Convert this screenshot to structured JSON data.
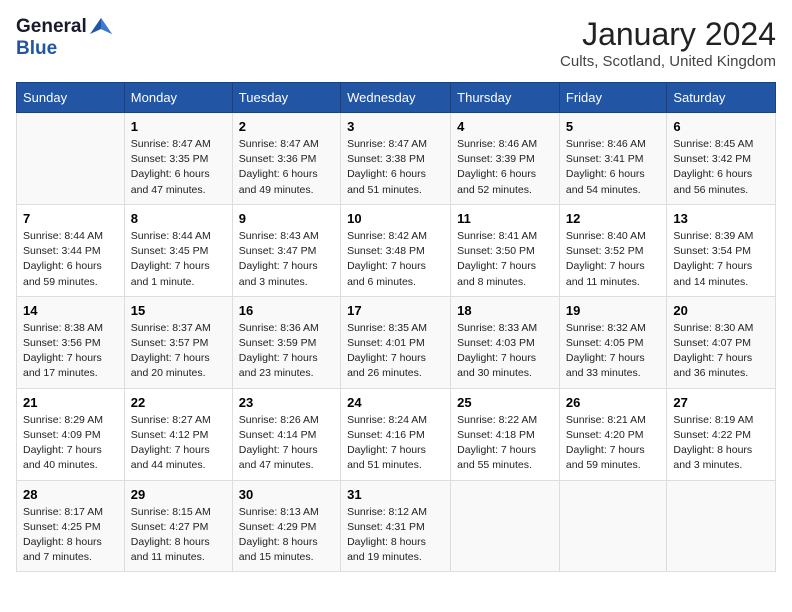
{
  "logo": {
    "general": "General",
    "blue": "Blue"
  },
  "title": "January 2024",
  "location": "Cults, Scotland, United Kingdom",
  "weekdays": [
    "Sunday",
    "Monday",
    "Tuesday",
    "Wednesday",
    "Thursday",
    "Friday",
    "Saturday"
  ],
  "weeks": [
    [
      {
        "day": "",
        "sunrise": "",
        "sunset": "",
        "daylight": ""
      },
      {
        "day": "1",
        "sunrise": "Sunrise: 8:47 AM",
        "sunset": "Sunset: 3:35 PM",
        "daylight": "Daylight: 6 hours and 47 minutes."
      },
      {
        "day": "2",
        "sunrise": "Sunrise: 8:47 AM",
        "sunset": "Sunset: 3:36 PM",
        "daylight": "Daylight: 6 hours and 49 minutes."
      },
      {
        "day": "3",
        "sunrise": "Sunrise: 8:47 AM",
        "sunset": "Sunset: 3:38 PM",
        "daylight": "Daylight: 6 hours and 51 minutes."
      },
      {
        "day": "4",
        "sunrise": "Sunrise: 8:46 AM",
        "sunset": "Sunset: 3:39 PM",
        "daylight": "Daylight: 6 hours and 52 minutes."
      },
      {
        "day": "5",
        "sunrise": "Sunrise: 8:46 AM",
        "sunset": "Sunset: 3:41 PM",
        "daylight": "Daylight: 6 hours and 54 minutes."
      },
      {
        "day": "6",
        "sunrise": "Sunrise: 8:45 AM",
        "sunset": "Sunset: 3:42 PM",
        "daylight": "Daylight: 6 hours and 56 minutes."
      }
    ],
    [
      {
        "day": "7",
        "sunrise": "Sunrise: 8:44 AM",
        "sunset": "Sunset: 3:44 PM",
        "daylight": "Daylight: 6 hours and 59 minutes."
      },
      {
        "day": "8",
        "sunrise": "Sunrise: 8:44 AM",
        "sunset": "Sunset: 3:45 PM",
        "daylight": "Daylight: 7 hours and 1 minute."
      },
      {
        "day": "9",
        "sunrise": "Sunrise: 8:43 AM",
        "sunset": "Sunset: 3:47 PM",
        "daylight": "Daylight: 7 hours and 3 minutes."
      },
      {
        "day": "10",
        "sunrise": "Sunrise: 8:42 AM",
        "sunset": "Sunset: 3:48 PM",
        "daylight": "Daylight: 7 hours and 6 minutes."
      },
      {
        "day": "11",
        "sunrise": "Sunrise: 8:41 AM",
        "sunset": "Sunset: 3:50 PM",
        "daylight": "Daylight: 7 hours and 8 minutes."
      },
      {
        "day": "12",
        "sunrise": "Sunrise: 8:40 AM",
        "sunset": "Sunset: 3:52 PM",
        "daylight": "Daylight: 7 hours and 11 minutes."
      },
      {
        "day": "13",
        "sunrise": "Sunrise: 8:39 AM",
        "sunset": "Sunset: 3:54 PM",
        "daylight": "Daylight: 7 hours and 14 minutes."
      }
    ],
    [
      {
        "day": "14",
        "sunrise": "Sunrise: 8:38 AM",
        "sunset": "Sunset: 3:56 PM",
        "daylight": "Daylight: 7 hours and 17 minutes."
      },
      {
        "day": "15",
        "sunrise": "Sunrise: 8:37 AM",
        "sunset": "Sunset: 3:57 PM",
        "daylight": "Daylight: 7 hours and 20 minutes."
      },
      {
        "day": "16",
        "sunrise": "Sunrise: 8:36 AM",
        "sunset": "Sunset: 3:59 PM",
        "daylight": "Daylight: 7 hours and 23 minutes."
      },
      {
        "day": "17",
        "sunrise": "Sunrise: 8:35 AM",
        "sunset": "Sunset: 4:01 PM",
        "daylight": "Daylight: 7 hours and 26 minutes."
      },
      {
        "day": "18",
        "sunrise": "Sunrise: 8:33 AM",
        "sunset": "Sunset: 4:03 PM",
        "daylight": "Daylight: 7 hours and 30 minutes."
      },
      {
        "day": "19",
        "sunrise": "Sunrise: 8:32 AM",
        "sunset": "Sunset: 4:05 PM",
        "daylight": "Daylight: 7 hours and 33 minutes."
      },
      {
        "day": "20",
        "sunrise": "Sunrise: 8:30 AM",
        "sunset": "Sunset: 4:07 PM",
        "daylight": "Daylight: 7 hours and 36 minutes."
      }
    ],
    [
      {
        "day": "21",
        "sunrise": "Sunrise: 8:29 AM",
        "sunset": "Sunset: 4:09 PM",
        "daylight": "Daylight: 7 hours and 40 minutes."
      },
      {
        "day": "22",
        "sunrise": "Sunrise: 8:27 AM",
        "sunset": "Sunset: 4:12 PM",
        "daylight": "Daylight: 7 hours and 44 minutes."
      },
      {
        "day": "23",
        "sunrise": "Sunrise: 8:26 AM",
        "sunset": "Sunset: 4:14 PM",
        "daylight": "Daylight: 7 hours and 47 minutes."
      },
      {
        "day": "24",
        "sunrise": "Sunrise: 8:24 AM",
        "sunset": "Sunset: 4:16 PM",
        "daylight": "Daylight: 7 hours and 51 minutes."
      },
      {
        "day": "25",
        "sunrise": "Sunrise: 8:22 AM",
        "sunset": "Sunset: 4:18 PM",
        "daylight": "Daylight: 7 hours and 55 minutes."
      },
      {
        "day": "26",
        "sunrise": "Sunrise: 8:21 AM",
        "sunset": "Sunset: 4:20 PM",
        "daylight": "Daylight: 7 hours and 59 minutes."
      },
      {
        "day": "27",
        "sunrise": "Sunrise: 8:19 AM",
        "sunset": "Sunset: 4:22 PM",
        "daylight": "Daylight: 8 hours and 3 minutes."
      }
    ],
    [
      {
        "day": "28",
        "sunrise": "Sunrise: 8:17 AM",
        "sunset": "Sunset: 4:25 PM",
        "daylight": "Daylight: 8 hours and 7 minutes."
      },
      {
        "day": "29",
        "sunrise": "Sunrise: 8:15 AM",
        "sunset": "Sunset: 4:27 PM",
        "daylight": "Daylight: 8 hours and 11 minutes."
      },
      {
        "day": "30",
        "sunrise": "Sunrise: 8:13 AM",
        "sunset": "Sunset: 4:29 PM",
        "daylight": "Daylight: 8 hours and 15 minutes."
      },
      {
        "day": "31",
        "sunrise": "Sunrise: 8:12 AM",
        "sunset": "Sunset: 4:31 PM",
        "daylight": "Daylight: 8 hours and 19 minutes."
      },
      {
        "day": "",
        "sunrise": "",
        "sunset": "",
        "daylight": ""
      },
      {
        "day": "",
        "sunrise": "",
        "sunset": "",
        "daylight": ""
      },
      {
        "day": "",
        "sunrise": "",
        "sunset": "",
        "daylight": ""
      }
    ]
  ]
}
